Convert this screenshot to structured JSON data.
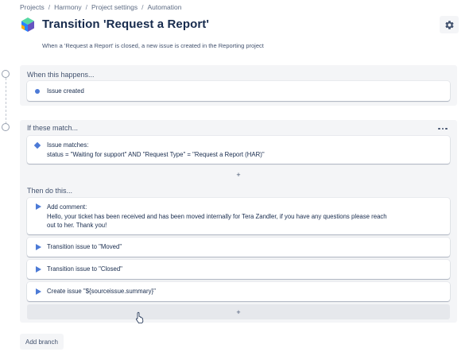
{
  "breadcrumb": {
    "items": [
      "Projects",
      "Harmony",
      "Project settings",
      "Automation"
    ],
    "separator": "/"
  },
  "header": {
    "title": "Transition 'Request a Report'",
    "description": "When a 'Request a Report' is closed, a new issue is created in the Reporting project",
    "settings_icon": "gear-icon"
  },
  "trigger_section": {
    "title": "When this happens...",
    "item": {
      "label": "Issue created",
      "icon": "dot-icon"
    }
  },
  "condition_section": {
    "title": "If these match...",
    "more_icon": "more-icon",
    "item": {
      "line1": "Issue matches:",
      "line2": "status = \"Waiting for support\" AND \"Request Type\" = \"Request a Report (HAR)\"",
      "icon": "diamond-icon"
    },
    "add_label": "+"
  },
  "action_section": {
    "title": "Then do this...",
    "comment": {
      "line1": "Add comment:",
      "line2": "Hello, your ticket has been received and has been moved internally for Tera Zandler, if you have any questions please reach",
      "line3": "out to her. Thank you!"
    },
    "actions": [
      "Transition issue to \"Moved\"",
      "Transition issue to \"Closed\"",
      "Create issue \"${sourceissue.summary}\""
    ],
    "add_label": "+"
  },
  "footer": {
    "add_branch_label": "Add branch"
  },
  "colors": {
    "accent": "#4c7ad6",
    "section_bg": "#f4f5f7",
    "text_primary": "#172b4d",
    "text_secondary": "#42526e"
  }
}
